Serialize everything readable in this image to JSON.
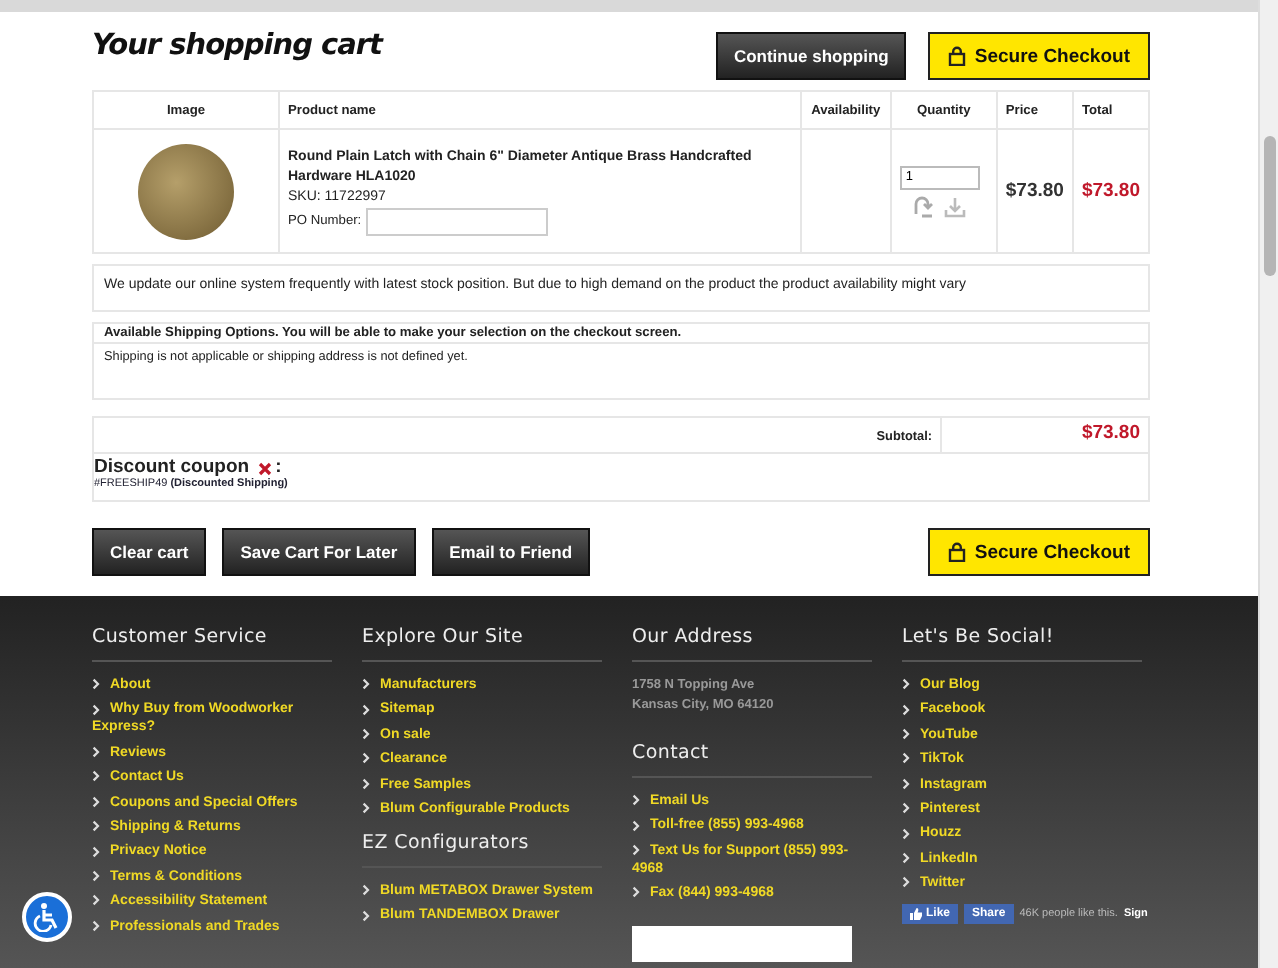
{
  "cart": {
    "title": "Your shopping cart",
    "top_buttons": [
      {
        "label": "Continue shopping",
        "kind": "dark"
      },
      {
        "label": "Secure Checkout",
        "kind": "checkout"
      }
    ],
    "table": {
      "columns": [
        "Image",
        "Product name",
        "Availability",
        "Quantity",
        "Price",
        "Total"
      ],
      "rows": [
        {
          "product_name": "Round Plain Latch with Chain 6\" Diameter Antique Brass Handcrafted Hardware HLA1020",
          "sku": "SKU: 11722997",
          "po_label": "PO Number:",
          "quantity": "1",
          "price": "$73.80",
          "total": "$73.80"
        }
      ]
    },
    "stock_notice": "We update our online system frequently with latest stock position. But due to high demand on the product the product availability might vary",
    "shipping": {
      "heading": "Available Shipping Options. You will be able to make your selection on the checkout screen.",
      "message": "Shipping is not applicable or shipping address is not defined yet."
    },
    "subtotal": {
      "label": "Subtotal:",
      "value": "$73.80"
    },
    "discount": {
      "label": "Discount coupon",
      "suffix": ":",
      "code": "#FREESHIP49",
      "description": "(Discounted Shipping)"
    },
    "bottom_buttons": [
      {
        "label": "Clear cart",
        "kind": "dark"
      },
      {
        "label": "Save Cart For Later",
        "kind": "dark"
      },
      {
        "label": "Email to Friend",
        "kind": "dark"
      },
      {
        "label": "Secure Checkout",
        "kind": "checkout"
      }
    ]
  },
  "footer": {
    "columns": [
      {
        "sections": [
          {
            "heading": "Customer Service",
            "kind": "links",
            "items": [
              "About",
              "Why Buy from Woodworker Express?",
              "Reviews",
              "Contact Us",
              "Coupons and Special Offers",
              "Shipping & Returns",
              "Privacy Notice",
              "Terms & Conditions",
              "Accessibility Statement",
              "Professionals and Trades"
            ]
          }
        ]
      },
      {
        "sections": [
          {
            "heading": "Explore Our Site",
            "kind": "links",
            "items": [
              "Manufacturers",
              "Sitemap",
              "On sale",
              "Clearance",
              "Free Samples",
              "Blum Configurable Products"
            ]
          },
          {
            "heading": "EZ Configurators",
            "kind": "links",
            "items": [
              "Blum METABOX Drawer System",
              "Blum TANDEMBOX Drawer"
            ]
          }
        ]
      },
      {
        "sections": [
          {
            "heading": "Our Address",
            "kind": "address",
            "items": [
              "1758 N Topping Ave",
              "Kansas City, MO 64120"
            ]
          },
          {
            "heading": "Contact",
            "kind": "links",
            "items": [
              "Email Us",
              "Toll-free (855) 993-4968",
              "Text Us for Support (855) 993-4968",
              "Fax (844) 993-4968"
            ]
          },
          {
            "kind": "logo"
          }
        ]
      },
      {
        "sections": [
          {
            "heading": "Let's Be Social!",
            "kind": "links",
            "items": [
              "Our Blog",
              "Facebook",
              "YouTube",
              "TikTok",
              "Instagram",
              "Pinterest",
              "Houzz",
              "LinkedIn",
              "Twitter"
            ]
          },
          {
            "kind": "social_widget",
            "like": "Like",
            "share": "Share",
            "count": "46K people like this.",
            "sign": "Sign"
          }
        ]
      }
    ]
  }
}
